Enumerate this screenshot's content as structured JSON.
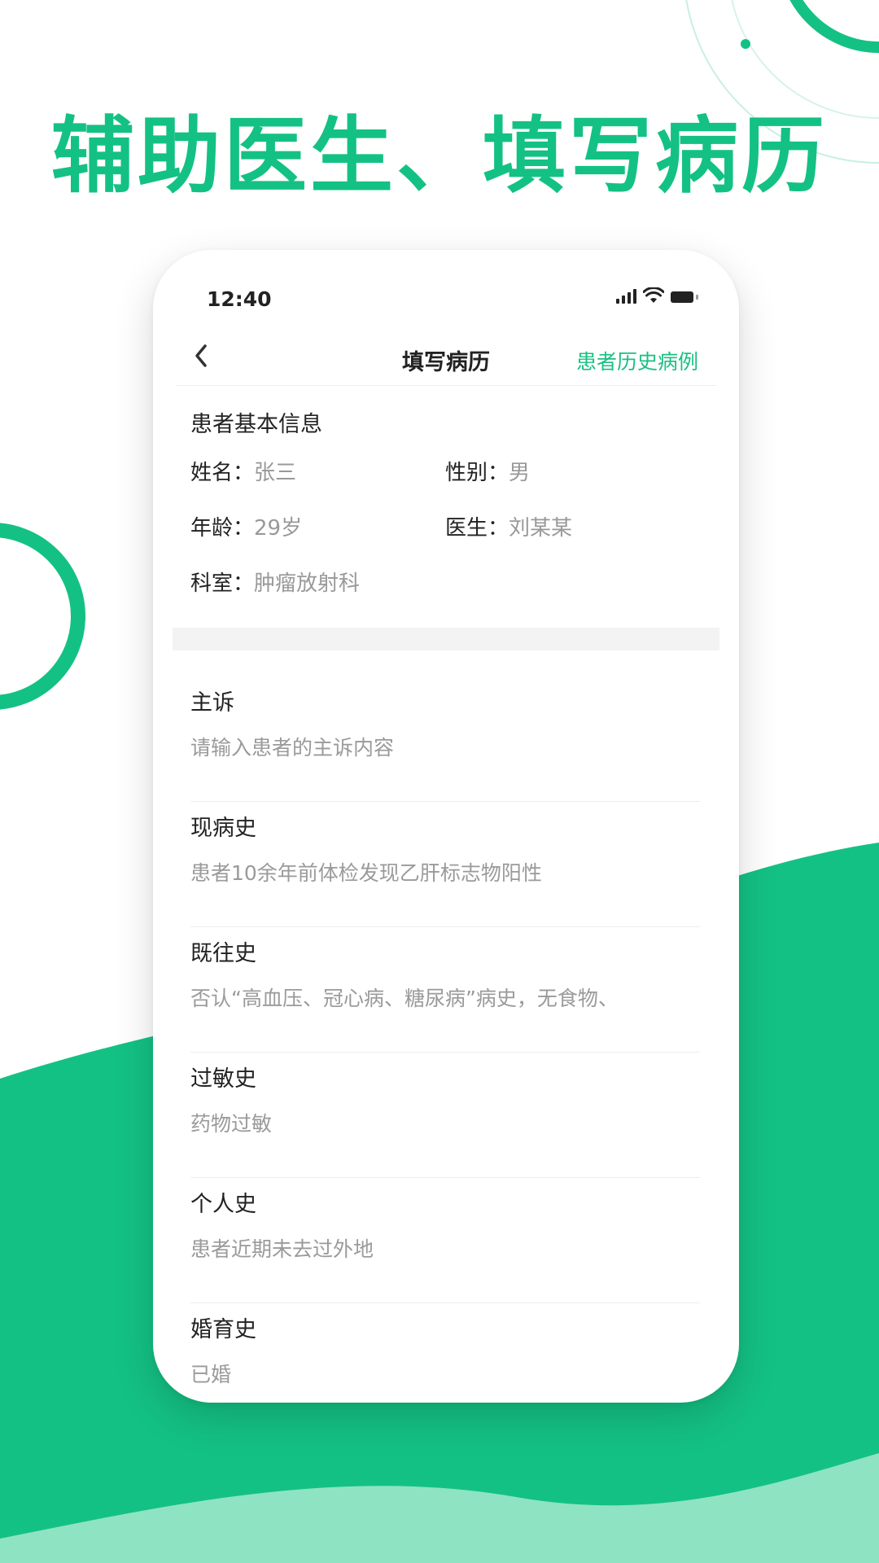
{
  "headline": "辅助医生、填写病历",
  "colors": {
    "brand_green": "#14c184",
    "light_green": "#8ee3c3",
    "link_green": "#1bbf84"
  },
  "status_bar": {
    "time": "12:40",
    "icons": [
      "signal-icon",
      "wifi-icon",
      "battery-icon"
    ]
  },
  "nav": {
    "back_icon": "back-chevron-icon",
    "title": "填写病历",
    "action": "患者历史病例"
  },
  "patient_info": {
    "title": "患者基本信息",
    "fields": [
      {
        "label": "姓名：",
        "value": "张三"
      },
      {
        "label": "性别：",
        "value": "男"
      },
      {
        "label": "年龄：",
        "value": "29岁"
      },
      {
        "label": "医生：",
        "value": "刘某某"
      },
      {
        "label": "科室：",
        "value": "肿瘤放射科"
      }
    ]
  },
  "records": [
    {
      "label": "主诉",
      "value": "请输入患者的主诉内容"
    },
    {
      "label": "现病史",
      "value": "患者10余年前体检发现乙肝标志物阳性"
    },
    {
      "label": "既往史",
      "value": "否认“高血压、冠心病、糖尿病”病史，无食物、"
    },
    {
      "label": "过敏史",
      "value": "药物过敏"
    },
    {
      "label": "个人史",
      "value": "患者近期未去过外地"
    },
    {
      "label": "婚育史",
      "value": "已婚"
    }
  ]
}
